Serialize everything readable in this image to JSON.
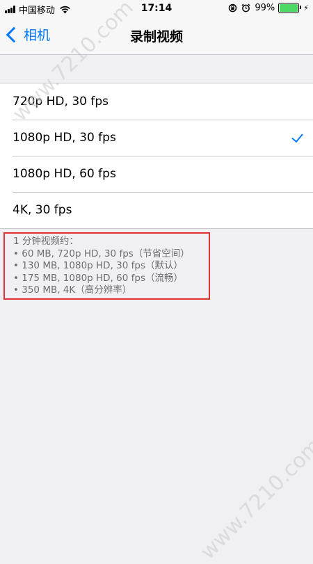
{
  "status_bar": {
    "carrier": "中国移动",
    "time": "17:14",
    "battery_percent": "99%",
    "battery_level": 0.99,
    "battery_color": "#4cd964"
  },
  "nav": {
    "back_label": "相机",
    "title": "录制视频"
  },
  "options": [
    {
      "label": "720p HD, 30 fps",
      "selected": false
    },
    {
      "label": "1080p HD, 30 fps",
      "selected": true
    },
    {
      "label": "1080p HD, 60 fps",
      "selected": false
    },
    {
      "label": "4K, 30 fps",
      "selected": false
    }
  ],
  "footer": {
    "heading": "1 分钟视频约：",
    "lines": [
      "• 60 MB, 720p HD, 30 fps（节省空间）",
      "• 130 MB, 1080p HD, 30 fps（默认）",
      "• 175 MB, 1080p HD, 60 fps（流畅）",
      "• 350 MB, 4K（高分辨率）"
    ]
  },
  "watermark": {
    "top_text": "www.7210.com",
    "bottom_text": "www.7210.com"
  },
  "colors": {
    "accent": "#007aff",
    "highlight_border": "#e0312f",
    "background": "#efeff4"
  }
}
